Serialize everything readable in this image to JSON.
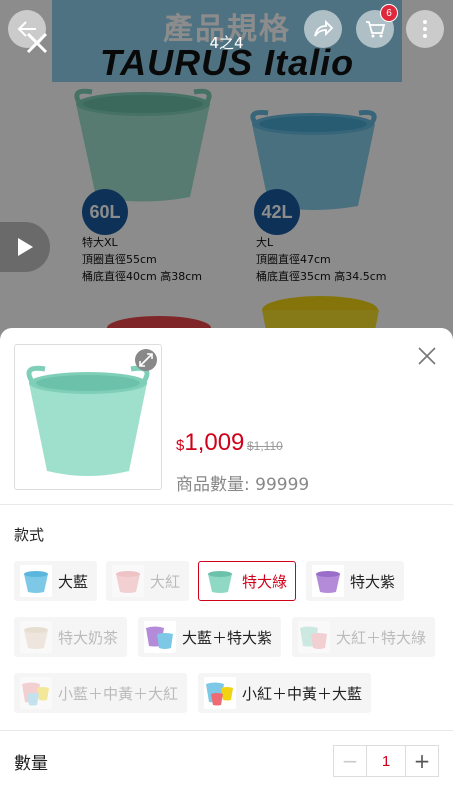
{
  "background": {
    "banner_title": "產品規格",
    "banner_brand": "TAURUS Italio",
    "products": [
      {
        "size": "60L",
        "spec_lines": [
          "特大XL",
          "頂圈直徑55cm",
          "桶底直徑40cm 高38cm"
        ]
      },
      {
        "size": "42L",
        "spec_lines": [
          "大L",
          "頂圈直徑47cm",
          "桶底直徑35cm 高34.5cm"
        ]
      }
    ]
  },
  "viewer": {
    "counter": "4之4",
    "cart_count": "6",
    "icons": [
      "back-icon",
      "share-icon",
      "cart-icon",
      "more-icon",
      "close-icon",
      "play-icon"
    ]
  },
  "sheet": {
    "price_currency": "$",
    "price_amount": "1,009",
    "original_price": "$1,110",
    "stock_text": "商品數量: 99999",
    "style_label": "款式",
    "quantity_label": "數量",
    "quantity_value": "1",
    "minus_label": "−",
    "plus_label": "+",
    "colors": {
      "accent": "#d0011b",
      "tub_green": "#8fd8c4",
      "tub_blue": "#7cc8e6"
    },
    "options": [
      {
        "label": "大藍",
        "state": "available"
      },
      {
        "label": "大紅",
        "state": "disabled"
      },
      {
        "label": "特大綠",
        "state": "selected"
      },
      {
        "label": "特大紫",
        "state": "available"
      },
      {
        "label": "特大奶茶",
        "state": "disabled"
      },
      {
        "label": "大藍＋特大紫",
        "state": "available"
      },
      {
        "label": "大紅＋特大綠",
        "state": "disabled"
      },
      {
        "label": "小藍＋中黃＋大紅",
        "state": "disabled"
      },
      {
        "label": "小紅＋中黃＋大藍",
        "state": "available"
      }
    ]
  }
}
